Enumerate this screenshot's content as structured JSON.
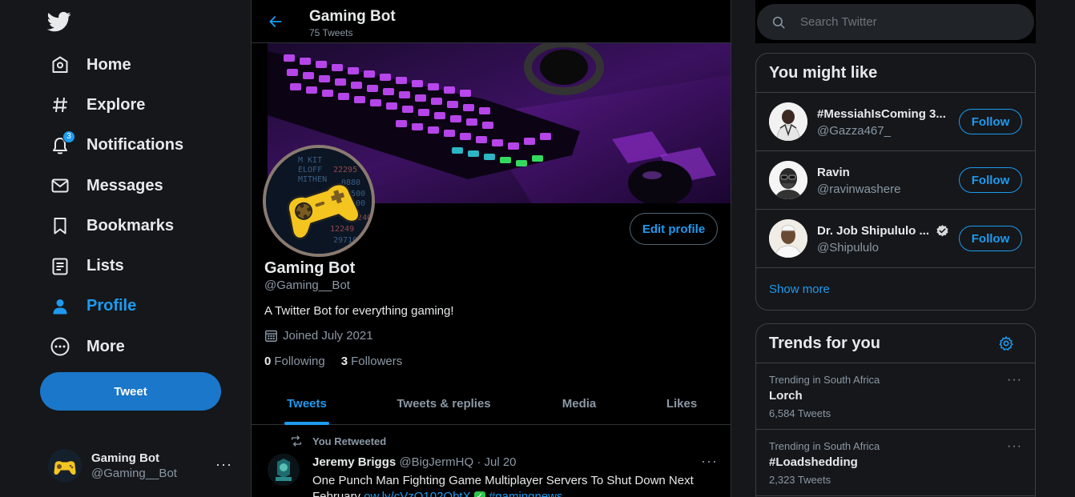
{
  "sidebar": {
    "logo": "twitter-bird-icon",
    "items": [
      {
        "label": "Home",
        "icon": "home-icon"
      },
      {
        "label": "Explore",
        "icon": "hashtag-icon"
      },
      {
        "label": "Notifications",
        "icon": "bell-icon",
        "badge": "3"
      },
      {
        "label": "Messages",
        "icon": "envelope-icon"
      },
      {
        "label": "Bookmarks",
        "icon": "bookmark-icon"
      },
      {
        "label": "Lists",
        "icon": "list-icon"
      },
      {
        "label": "Profile",
        "icon": "person-icon",
        "active": true
      },
      {
        "label": "More",
        "icon": "more-circle-icon"
      }
    ],
    "tweet_button": "Tweet",
    "account": {
      "name": "Gaming Bot",
      "handle": "@Gaming__Bot",
      "more": "···"
    }
  },
  "header": {
    "title": "Gaming Bot",
    "subtitle": "75 Tweets"
  },
  "profile": {
    "edit_button": "Edit profile",
    "name": "Gaming Bot",
    "handle": "@Gaming__Bot",
    "bio": "A Twitter Bot for everything gaming!",
    "joined": "Joined July 2021",
    "following_count": "0",
    "following_label": "Following",
    "followers_count": "3",
    "followers_label": "Followers"
  },
  "tabs": [
    {
      "label": "Tweets",
      "active": true
    },
    {
      "label": "Tweets & replies"
    },
    {
      "label": "Media"
    },
    {
      "label": "Likes"
    }
  ],
  "tweet": {
    "context": "You Retweeted",
    "author": "Jeremy Briggs",
    "handle": "@BigJermHQ",
    "date": "· Jul 20",
    "more": "···",
    "text_line1": "One Punch Man Fighting Game Multiplayer Servers To Shut Down Next",
    "text_line2_prefix": "February ",
    "link": "ow.ly/cVzQ102QbtX",
    "hashtag": "#gamingnews"
  },
  "search": {
    "placeholder": "Search Twitter"
  },
  "who_to_follow": {
    "title": "You might like",
    "items": [
      {
        "name": "#MessiahIsComing 3...",
        "handle": "@Gazza467_",
        "button": "Follow"
      },
      {
        "name": "Ravin",
        "handle": "@ravinwashere",
        "button": "Follow"
      },
      {
        "name": "Dr. Job Shipululo ...",
        "handle": "@Shipululo",
        "button": "Follow",
        "verified": true
      }
    ],
    "show_more": "Show more"
  },
  "trends": {
    "title": "Trends for you",
    "items": [
      {
        "context": "Trending in South Africa",
        "name": "Lorch",
        "count": "6,584 Tweets"
      },
      {
        "context": "Trending in South Africa",
        "name": "#Loadshedding",
        "count": "2,323 Tweets"
      }
    ]
  },
  "colors": {
    "accent": "#1d9bf0",
    "background": "#15171a",
    "main_background": "#000000",
    "tweet_button": "#1a77c9"
  }
}
